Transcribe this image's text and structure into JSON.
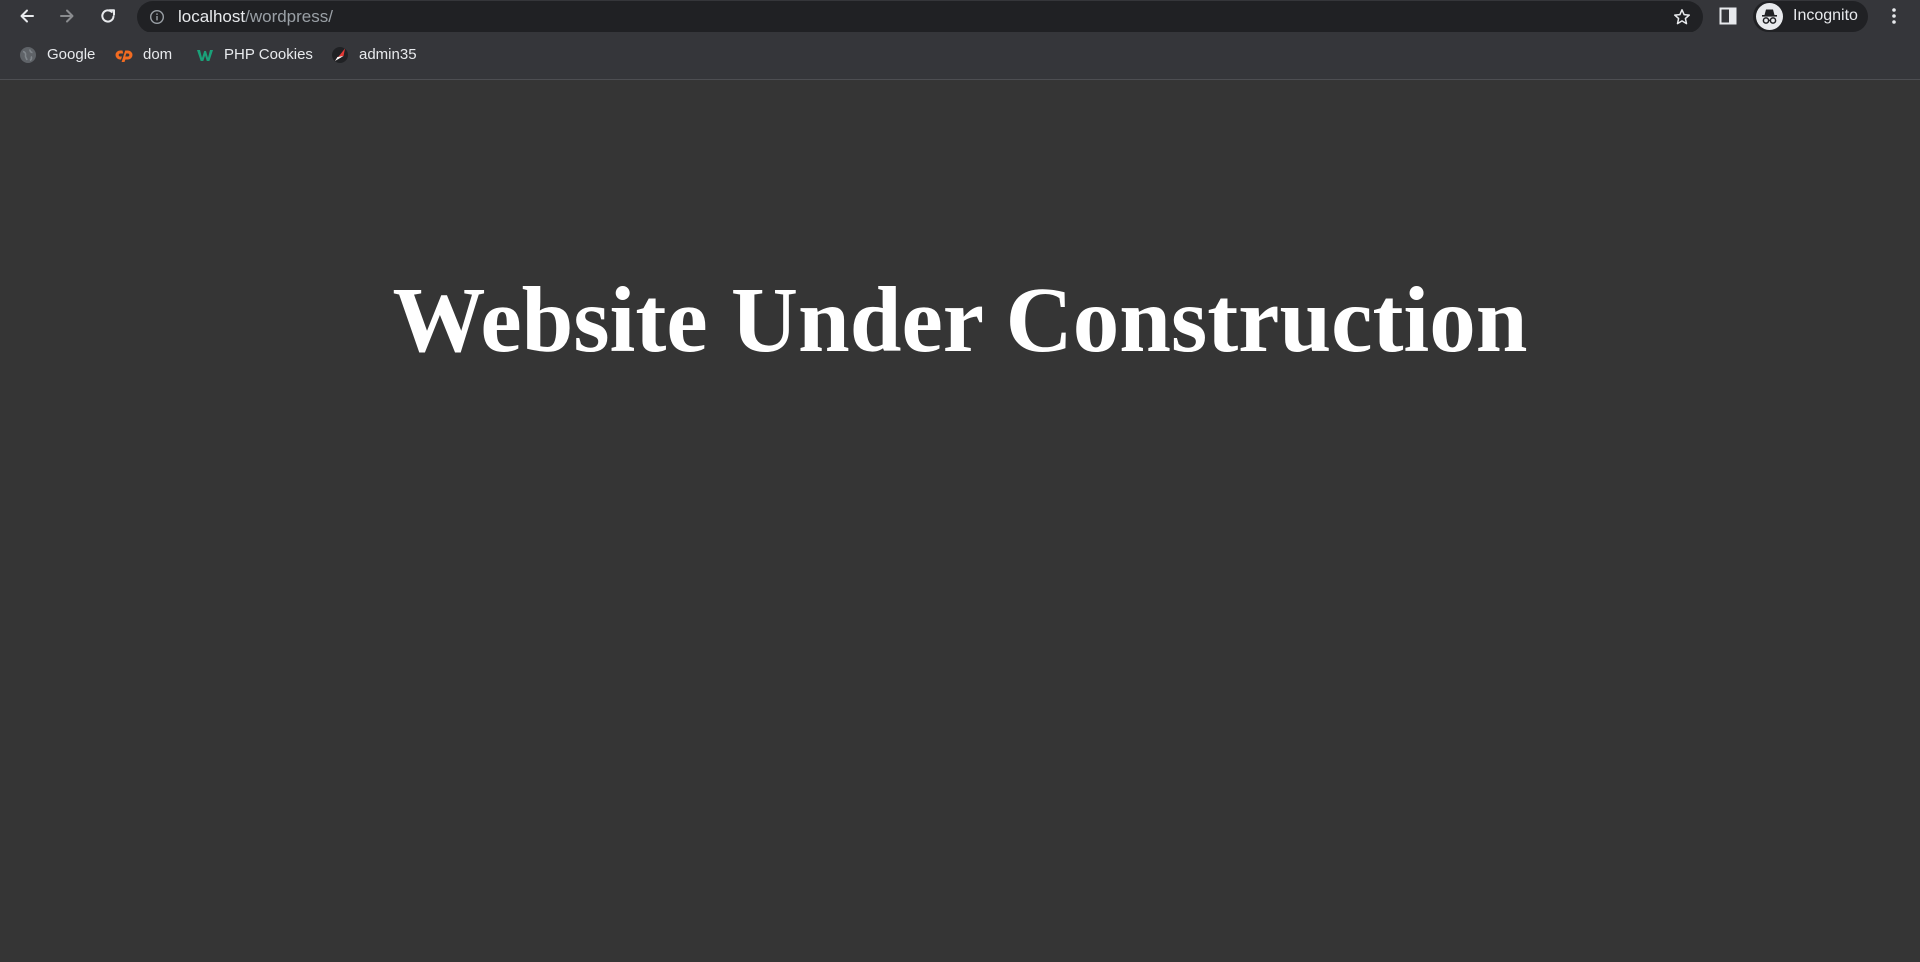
{
  "browser": {
    "address": {
      "host": "localhost",
      "path": "/wordpress/"
    },
    "profile": {
      "label": "Incognito"
    },
    "bookmarks": [
      {
        "label": "Google",
        "icon": "globe-icon"
      },
      {
        "label": "dom",
        "icon": "cpanel-icon"
      },
      {
        "label": "PHP Cookies",
        "icon": "w-logo-icon"
      },
      {
        "label": "admin35",
        "icon": "red-slash-icon"
      }
    ],
    "icons": [
      "back-arrow-icon",
      "forward-arrow-icon",
      "reload-icon",
      "info-icon",
      "star-icon",
      "side-panel-icon",
      "incognito-icon",
      "more-menu-icon"
    ]
  },
  "page": {
    "heading": "Website Under Construction"
  },
  "colors": {
    "page_background": "#353535",
    "toolbar_background": "#35363a",
    "omnibox_background": "#202124",
    "heading_text": "#ffffff",
    "cpanel_orange": "#f26b21",
    "w_logo_green": "#1aa179",
    "admin_red": "#e53935"
  }
}
